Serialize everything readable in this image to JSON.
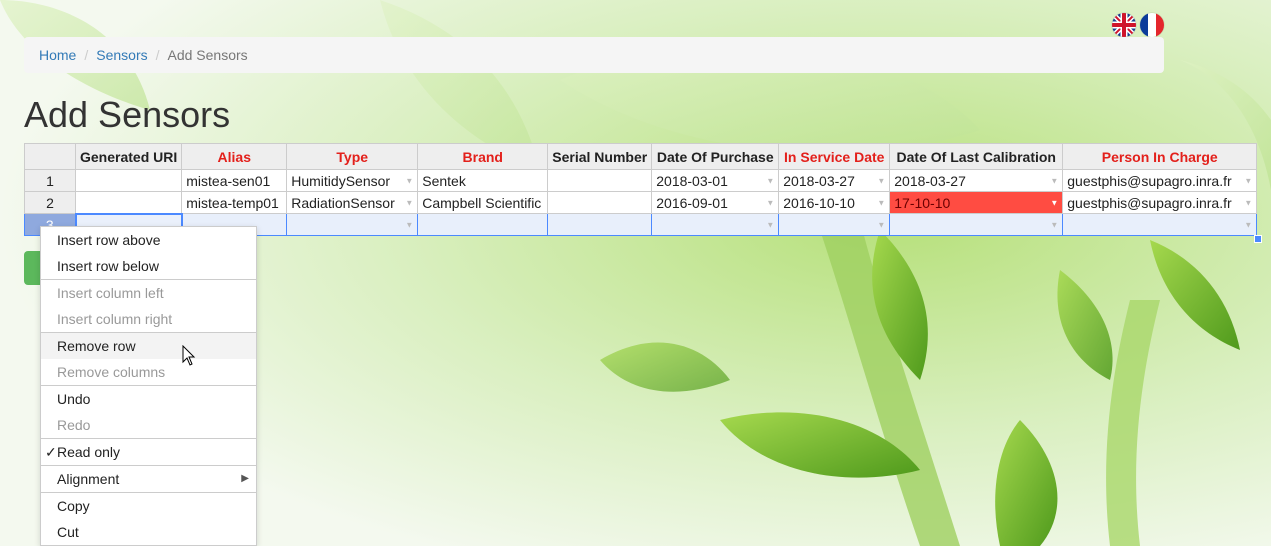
{
  "breadcrumb": {
    "home": "Home",
    "sensors": "Sensors",
    "current": "Add Sensors"
  },
  "page_title": "Add Sensors",
  "flags": [
    {
      "icon": "uk-flag-icon"
    },
    {
      "icon": "france-flag-icon"
    }
  ],
  "grid": {
    "headers": [
      "Generated URI",
      "Alias",
      "Type",
      "Brand",
      "Serial Number",
      "Date Of Purchase",
      "In Service Date",
      "Date Of Last Calibration",
      "Person In Charge"
    ],
    "rows": [
      {
        "num": "1",
        "cells": [
          "",
          "mistea-sen01",
          "HumitidySensor",
          "Sentek",
          "",
          "2018-03-01",
          "2018-03-27",
          "2018-03-27",
          "guestphis@supagro.inra.fr"
        ]
      },
      {
        "num": "2",
        "cells": [
          "",
          "mistea-temp01",
          "RadiationSensor",
          "Campbell Scientific",
          "",
          "2016-09-01",
          "2016-10-10",
          "17-10-10",
          "guestphis@supagro.inra.fr"
        ]
      },
      {
        "num": "3",
        "cells": [
          "",
          "",
          "",
          "",
          "",
          "",
          "",
          "",
          ""
        ]
      }
    ]
  },
  "context_menu": {
    "insert_row_above": "Insert row above",
    "insert_row_below": "Insert row below",
    "insert_col_left": "Insert column left",
    "insert_col_right": "Insert column right",
    "remove_row": "Remove row",
    "remove_columns": "Remove columns",
    "undo": "Undo",
    "redo": "Redo",
    "read_only": "Read only",
    "read_only_check": "✓",
    "alignment": "Alignment",
    "alignment_arrow": "▶",
    "copy": "Copy",
    "cut": "Cut"
  },
  "colors": {
    "required_header": "#e3201b",
    "invalid_cell": "#ff4c42",
    "selection": "#4b89ff",
    "link": "#337ab7"
  }
}
